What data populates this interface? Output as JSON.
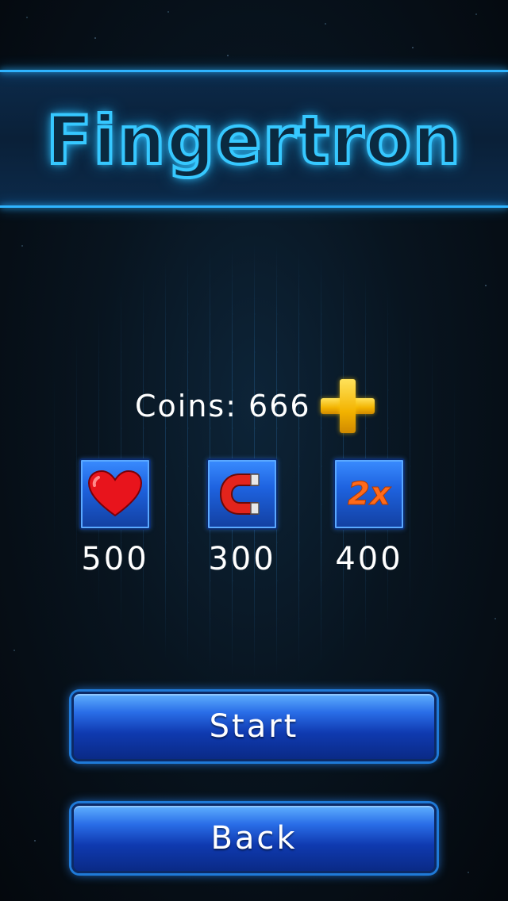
{
  "title": "Fingertron",
  "coins": {
    "label": "Coins:",
    "value": "666",
    "add_icon": "plus-icon",
    "add_color": "#f3b300"
  },
  "powerups": [
    {
      "icon": "heart-icon",
      "price": "500"
    },
    {
      "icon": "magnet-icon",
      "price": "300"
    },
    {
      "icon": "double-score-icon",
      "icon_text": "2x",
      "price": "400"
    }
  ],
  "buttons": {
    "start_label": "Start",
    "back_label": "Back"
  },
  "colors": {
    "accent": "#2fb4ff",
    "button": "#1e63e0",
    "background": "#08141f"
  }
}
